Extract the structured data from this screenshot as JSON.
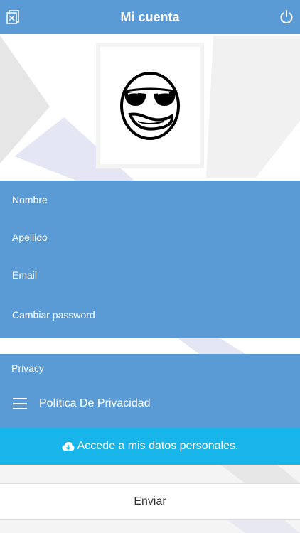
{
  "header": {
    "title": "Mi cuenta",
    "left_icon": "close-box-icon",
    "right_icon": "power-icon"
  },
  "avatar": {
    "icon": "sunglasses-smiley-icon"
  },
  "form": {
    "fields": [
      {
        "label": "Nombre"
      },
      {
        "label": "Apellido"
      },
      {
        "label": "Email"
      },
      {
        "label": "Cambiar password"
      }
    ]
  },
  "privacy": {
    "section_label": "Privacy",
    "link_label": "Política De Privacidad",
    "menu_icon": "hamburger-menu-icon"
  },
  "personal_data": {
    "label": "Accede a mis datos personales.",
    "icon": "cloud-download-icon"
  },
  "send": {
    "label": "Enviar"
  },
  "colors": {
    "primary": "#5b9bd5",
    "accent": "#17b5ea"
  }
}
